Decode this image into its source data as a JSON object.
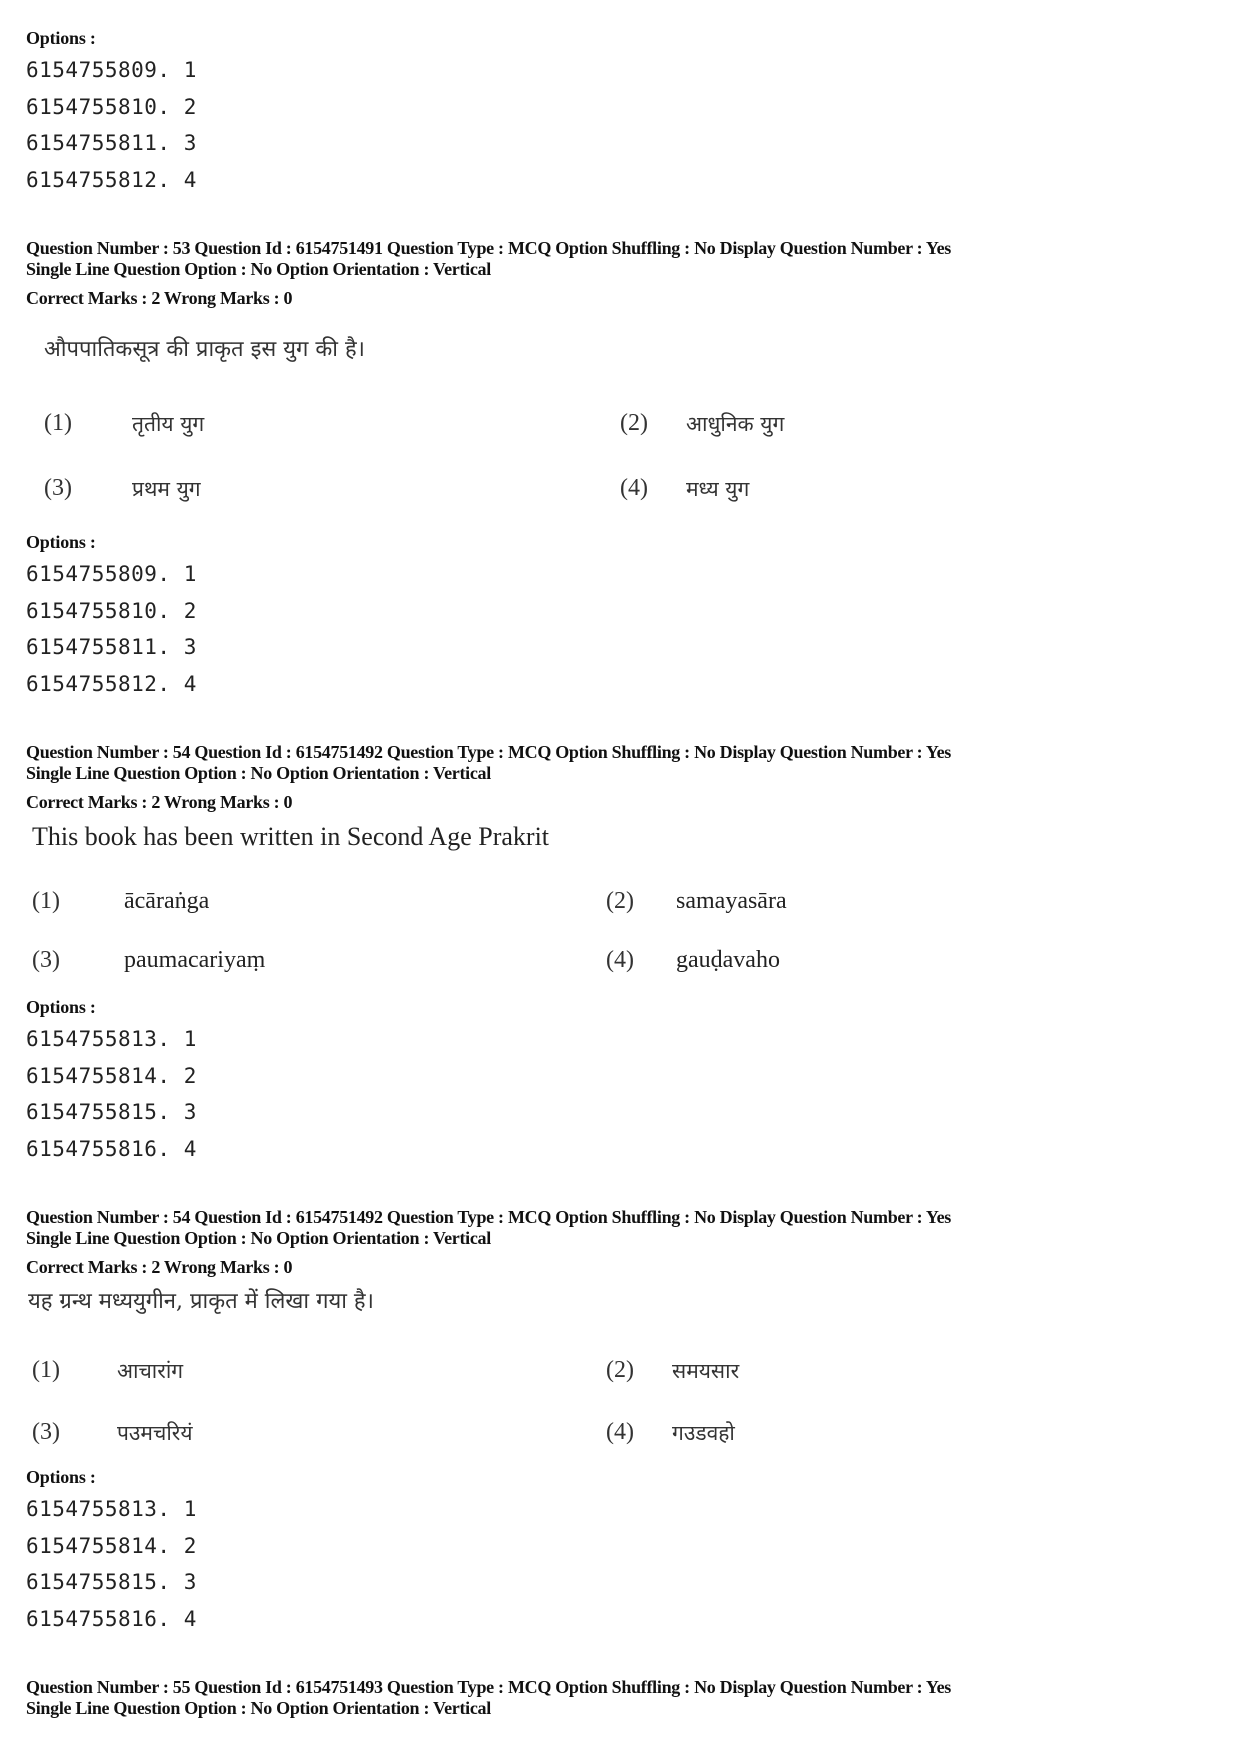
{
  "blocks": {
    "top_options": {
      "label": "Options :",
      "items": [
        "6154755809. 1",
        "6154755810. 2",
        "6154755811. 3",
        "6154755812. 4"
      ]
    },
    "q53": {
      "meta_line1": "Question Number : 53  Question Id : 6154751491  Question Type : MCQ  Option Shuffling : No  Display Question Number : Yes",
      "meta_line2": "Single Line Question Option : No  Option Orientation : Vertical",
      "marks": "Correct Marks : 2  Wrong Marks : 0",
      "question": "औपपातिकसूत्र की प्राकृत इस युग की है।",
      "choices": [
        {
          "num": "(1)",
          "text": "तृतीय युग"
        },
        {
          "num": "(2)",
          "text": "आधुनिक युग"
        },
        {
          "num": "(3)",
          "text": "प्रथम युग"
        },
        {
          "num": "(4)",
          "text": "मध्य युग"
        }
      ],
      "options_label": "Options :",
      "options": [
        "6154755809. 1",
        "6154755810. 2",
        "6154755811. 3",
        "6154755812. 4"
      ]
    },
    "q54_en": {
      "meta_line1": "Question Number : 54  Question Id : 6154751492  Question Type : MCQ  Option Shuffling : No  Display Question Number : Yes",
      "meta_line2": "Single Line Question Option : No  Option Orientation : Vertical",
      "marks": "Correct Marks : 2  Wrong Marks : 0",
      "question": "This book has been written in Second Age Prakrit",
      "choices": [
        {
          "num": "(1)",
          "text": "ācāraṅga"
        },
        {
          "num": "(2)",
          "text": "samayasāra"
        },
        {
          "num": "(3)",
          "text": "paumacariyaṃ"
        },
        {
          "num": "(4)",
          "text": "gauḍavaho"
        }
      ],
      "options_label": "Options :",
      "options": [
        "6154755813. 1",
        "6154755814. 2",
        "6154755815. 3",
        "6154755816. 4"
      ]
    },
    "q54_hi": {
      "meta_line1": "Question Number : 54  Question Id : 6154751492  Question Type : MCQ  Option Shuffling : No  Display Question Number : Yes",
      "meta_line2": "Single Line Question Option : No  Option Orientation : Vertical",
      "marks": "Correct Marks : 2  Wrong Marks : 0",
      "question": "यह ग्रन्थ मध्ययुगीन, प्राकृत में लिखा गया है।",
      "choices": [
        {
          "num": "(1)",
          "text": "आचारांग"
        },
        {
          "num": "(2)",
          "text": "समयसार"
        },
        {
          "num": "(3)",
          "text": "पउमचरियं"
        },
        {
          "num": "(4)",
          "text": "गउडवहो"
        }
      ],
      "options_label": "Options :",
      "options": [
        "6154755813. 1",
        "6154755814. 2",
        "6154755815. 3",
        "6154755816. 4"
      ]
    },
    "q55": {
      "meta_line1": "Question Number : 55  Question Id : 6154751493  Question Type : MCQ  Option Shuffling : No  Display Question Number : Yes",
      "meta_line2": "Single Line Question Option : No  Option Orientation : Vertical"
    }
  }
}
